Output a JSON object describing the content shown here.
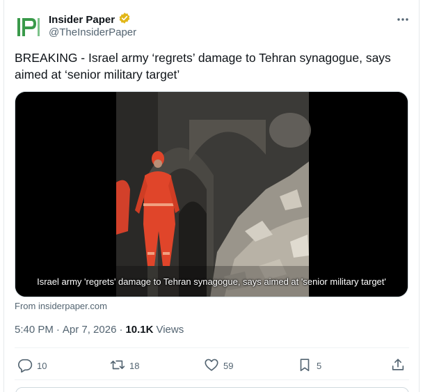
{
  "account": {
    "name": "Insider Paper",
    "handle": "@TheInsiderPaper",
    "logo_text": "IP"
  },
  "tweet": {
    "text": "BREAKING - Israel army ‘regrets’ damage to Tehran synagogue, says aimed at ‘senior military target’",
    "media_caption": "Israel army 'regrets' damage to Tehran synagogue, says aimed at 'senior military target'",
    "source": "From insiderpaper.com",
    "time": "5:40 PM",
    "date": "Apr 7, 2026",
    "views_count": "10.1K",
    "views_label": "Views"
  },
  "actions": {
    "replies": "10",
    "reposts": "18",
    "likes": "59",
    "bookmarks": "5"
  },
  "colors": {
    "logo_green": "#3a9a4a",
    "verified_gold": "#e2b719",
    "text_primary": "#0f1419",
    "text_secondary": "#536471",
    "ppe_orange": "#e0452a"
  }
}
